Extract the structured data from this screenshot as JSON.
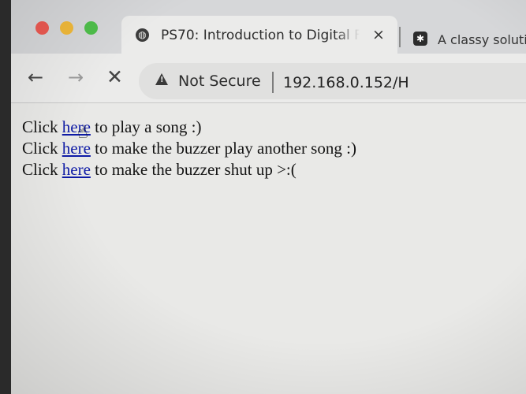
{
  "browser": {
    "tabs": [
      {
        "title": "PS70: Introduction to Digital F",
        "close": "×",
        "icon": "globe-icon"
      },
      {
        "title": "A classy soluti",
        "icon": "app-icon"
      }
    ],
    "nav": {
      "back": "←",
      "forward": "→",
      "stop": "✕"
    },
    "omnibox": {
      "security": "Not Secure",
      "url": "192.168.0.152/H"
    }
  },
  "page": {
    "lines": [
      {
        "prefix": "Click ",
        "link": "here",
        "suffix": " to play a song :)"
      },
      {
        "prefix": "Click ",
        "link": "here",
        "suffix": " to make the buzzer play another song :)"
      },
      {
        "prefix": "Click ",
        "link": "here",
        "suffix": " to make the buzzer shut up >:("
      }
    ]
  },
  "colors": {
    "link": "#0e1aa6",
    "close": "#ec5a52",
    "minimize": "#f0b93a",
    "zoom": "#4fbf4b"
  }
}
